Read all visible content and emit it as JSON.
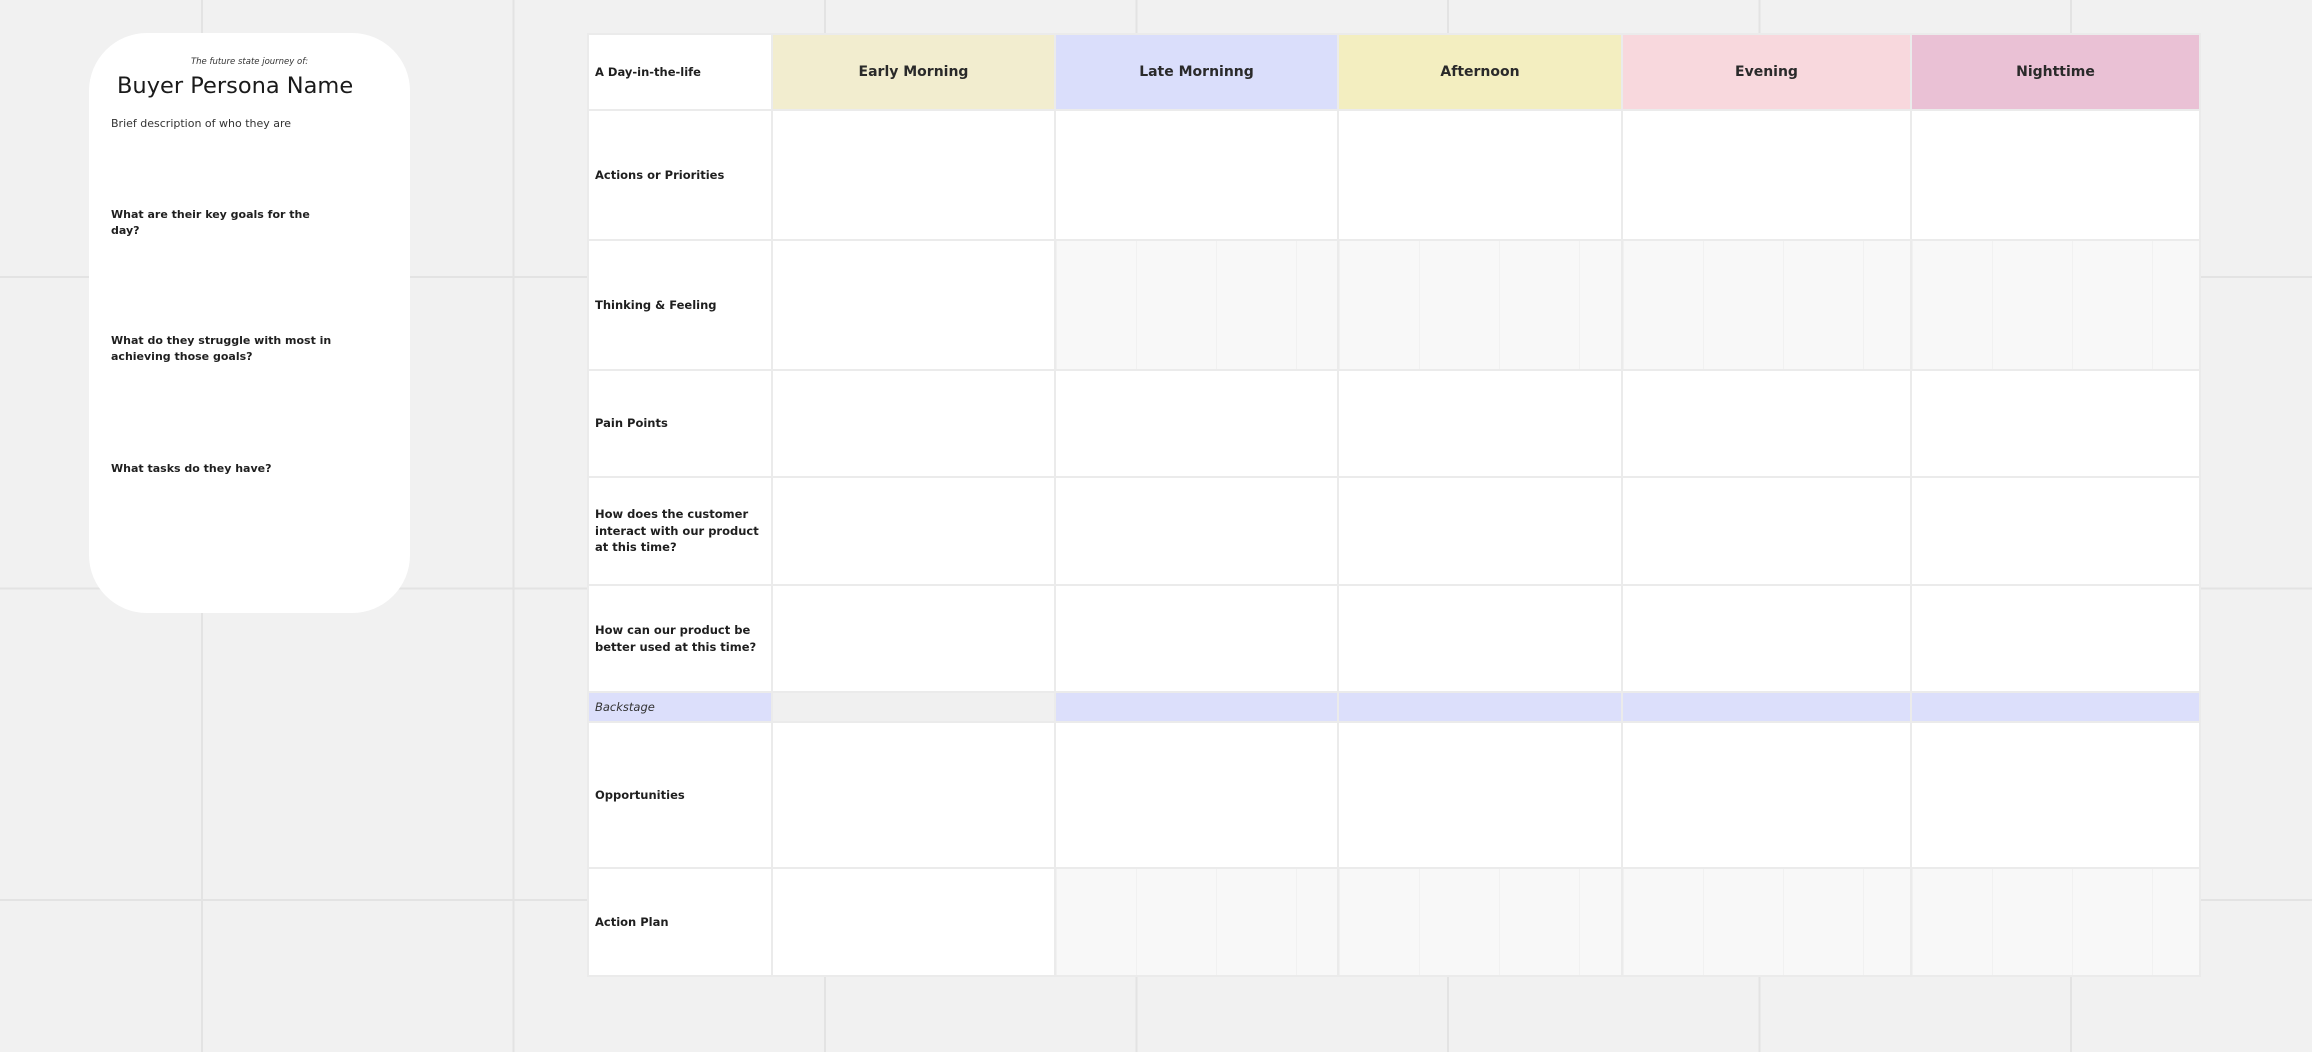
{
  "persona": {
    "eyebrow": "The future state journey of:",
    "name": "Buyer Persona Name",
    "description": "Brief description of who they are",
    "questions": [
      "What are their key goals for the day?",
      "What do they struggle with most in achieving those goals?",
      "What tasks do they have?"
    ]
  },
  "journey": {
    "corner_label": "A Day-in-the-life",
    "columns": [
      {
        "label": "Early Morning",
        "color": "#f2edcf"
      },
      {
        "label": "Late Morninng",
        "color": "#dadefb"
      },
      {
        "label": "Afternoon",
        "color": "#f3eec0"
      },
      {
        "label": "Evening",
        "color": "#f8d8dd"
      },
      {
        "label": "Nighttime",
        "color": "#eac1d5"
      }
    ],
    "rows": [
      "Actions or Priorities",
      "Thinking & Feeling",
      "Pain Points",
      "How does the customer interact with our product at this time?",
      "How can our product be better used at this time?",
      "Backstage",
      "Opportunities",
      "Action Plan"
    ]
  }
}
